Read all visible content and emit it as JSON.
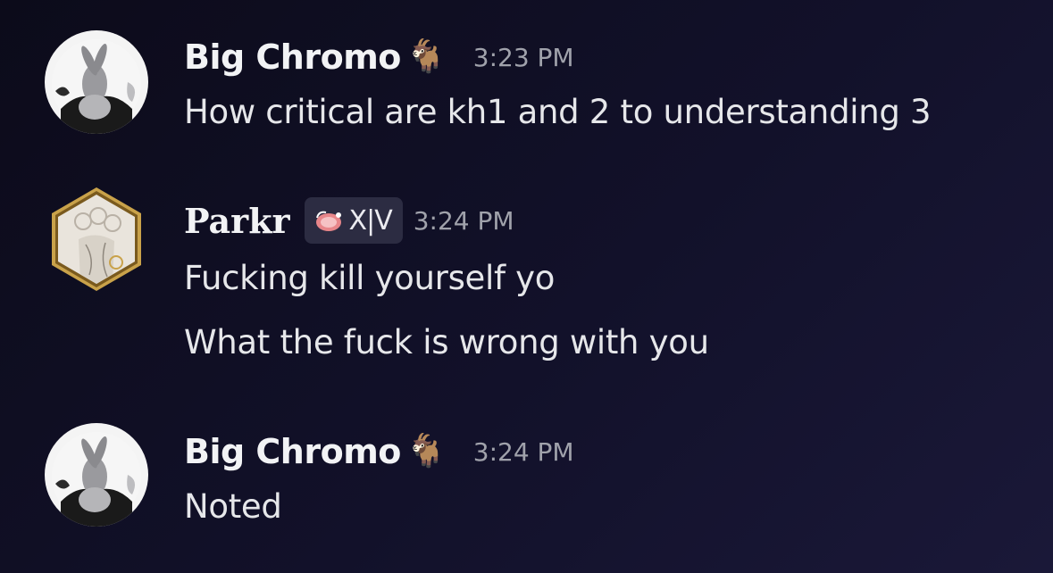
{
  "messages": [
    {
      "username": "Big Chromo",
      "username_emoji": "🐐",
      "timestamp": "3:23 PM",
      "avatar_icon": "rabbit-character-avatar",
      "lines": [
        "How critical are kh1 and 2 to understanding 3"
      ]
    },
    {
      "username": "Parkr",
      "tag": {
        "icon": "meat-icon",
        "text": "X|V"
      },
      "timestamp": "3:24 PM",
      "avatar_icon": "hexagon-framed-portrait-avatar",
      "lines": [
        "Fucking kill yourself yo",
        "What the fuck is wrong with you"
      ]
    },
    {
      "username": "Big Chromo",
      "username_emoji": "🐐",
      "timestamp": "3:24 PM",
      "avatar_icon": "rabbit-character-avatar",
      "lines": [
        "Noted"
      ]
    }
  ],
  "colors": {
    "background": "#12112a",
    "username": "#f2f3f5",
    "timestamp": "#a0a2ab",
    "message_text": "#e6e7ea",
    "tag_background": "#2c2c42",
    "avatar_ring": "#e8772e",
    "hexagon_frame": "#c9a24a"
  }
}
